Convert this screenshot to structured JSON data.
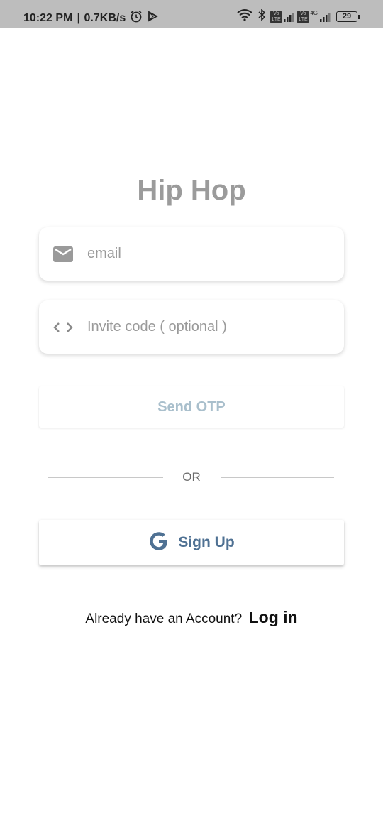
{
  "status_bar": {
    "time": "10:22 PM",
    "separator": "|",
    "speed": "0.7KB/s",
    "sim1_label": "Vo LTE",
    "sim2_label": "Vo LTE",
    "network_type": "4G",
    "battery": "29",
    "icons": [
      "alarm-icon",
      "play-icon",
      "wifi-icon",
      "bluetooth-icon",
      "signal-icon",
      "battery-icon"
    ]
  },
  "app": {
    "title": "Hip Hop"
  },
  "form": {
    "email_placeholder": "email",
    "email_value": "",
    "invite_placeholder": "Invite code ( optional )",
    "invite_value": "",
    "send_otp_label": "Send OTP",
    "or_label": "OR",
    "google_label": "Sign Up"
  },
  "footer": {
    "question": "Already have an Account?",
    "login_label": "Log in"
  },
  "colors": {
    "title": "#9b9b9b",
    "send_otp_text": "#a9bfcc",
    "google_text": "#4f7193",
    "status_bar_bg": "#bdbdbd"
  }
}
